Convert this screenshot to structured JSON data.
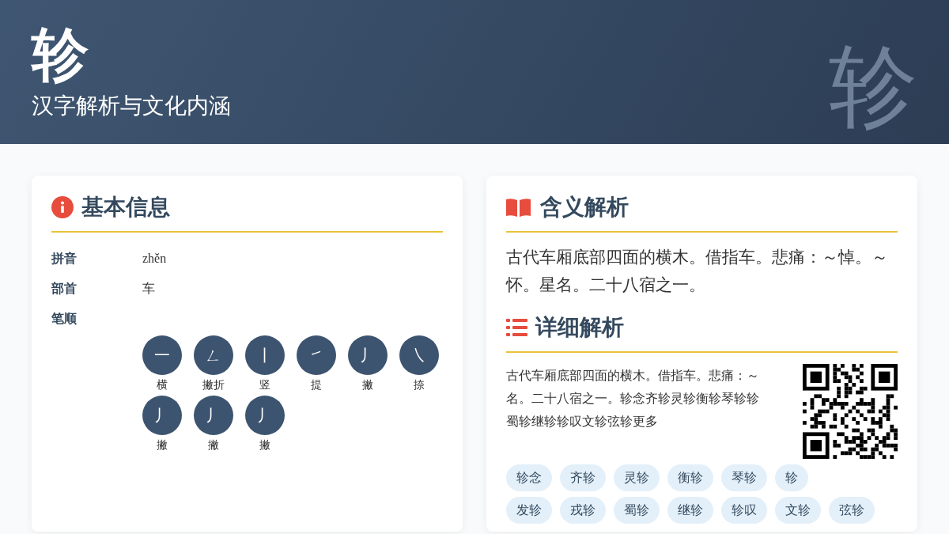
{
  "header": {
    "character": "轸",
    "subtitle": "汉字解析与文化内涵",
    "watermark": "轸"
  },
  "basic_info": {
    "title": "基本信息",
    "fields": [
      {
        "label": "拼音",
        "value": "zhěn"
      },
      {
        "label": "部首",
        "value": "车"
      }
    ],
    "stroke_order": {
      "label": "笔顺",
      "strokes": [
        {
          "glyph": "一",
          "name": "横"
        },
        {
          "glyph": "ㄥ",
          "name": "撇折"
        },
        {
          "glyph": "丨",
          "name": "竖"
        },
        {
          "glyph": "㇀",
          "name": "提"
        },
        {
          "glyph": "丿",
          "name": "撇"
        },
        {
          "glyph": "㇏",
          "name": "捺"
        },
        {
          "glyph": "丿",
          "name": "撇"
        },
        {
          "glyph": "丿",
          "name": "撇"
        },
        {
          "glyph": "丿",
          "name": "撇"
        }
      ]
    }
  },
  "meaning": {
    "title": "含义解析",
    "text": "古代车厢底部四面的横木。借指车。悲痛：～悼。～怀。星名。二十八宿之一。"
  },
  "details": {
    "title": "详细解析",
    "lines": [
      "古代车厢底部四面的横木。借指车。悲痛：～",
      "名。二十八宿之一。轸念齐轸灵轸衡轸琴轸轸",
      "蜀轸继轸轸叹文轸弦轸更多"
    ],
    "words": [
      [
        "轸念",
        "齐轸",
        "灵轸",
        "衡轸",
        "琴轸",
        "轸"
      ],
      [
        "发轸",
        "戎轸",
        "蜀轸",
        "继轸",
        "轸叹",
        "文轸",
        "弦轸"
      ]
    ]
  }
}
